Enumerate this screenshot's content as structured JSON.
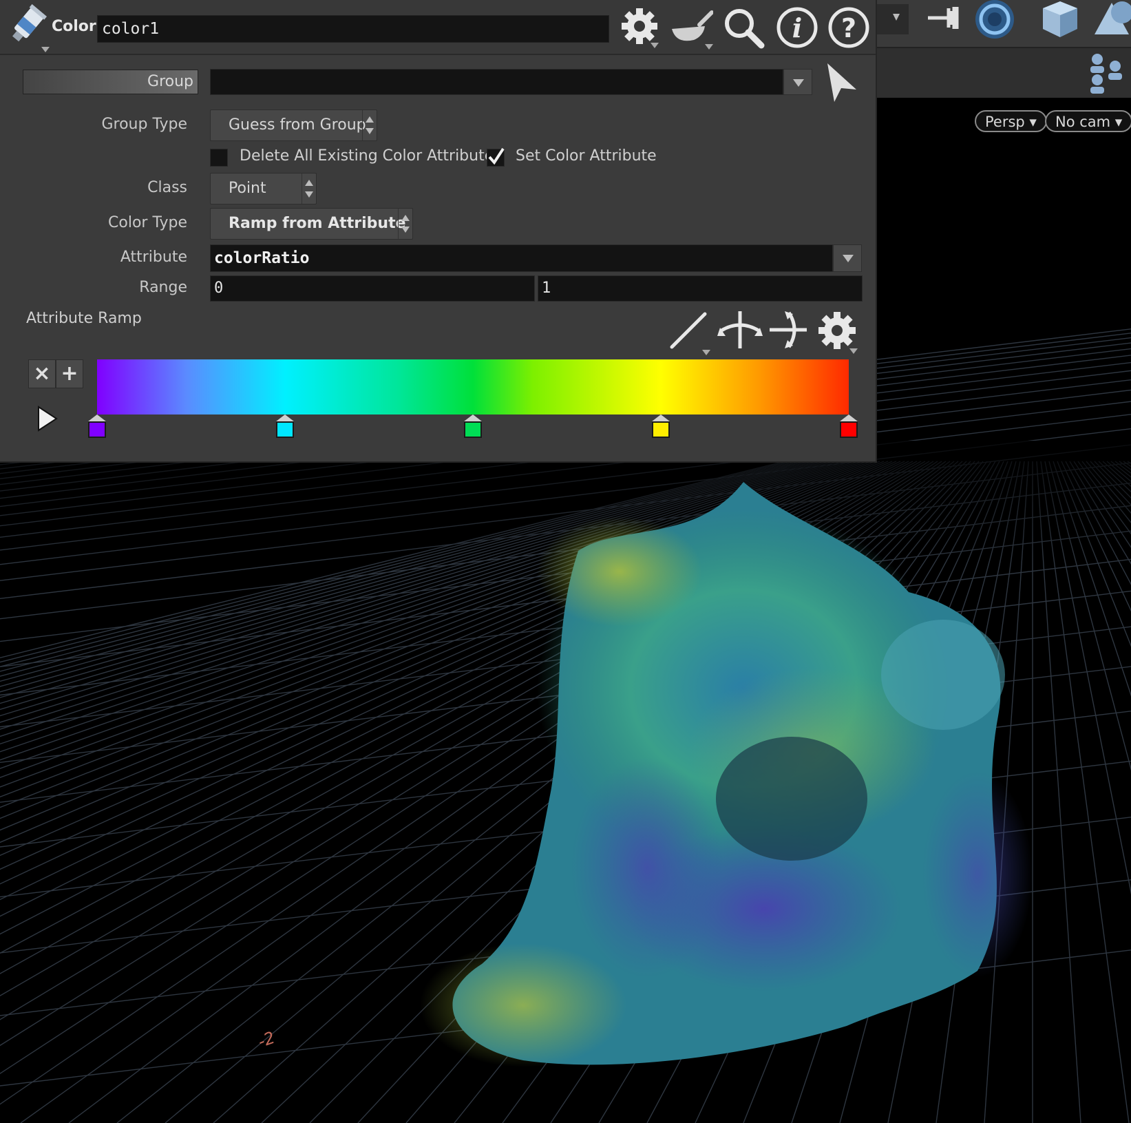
{
  "header": {
    "node_type": "Color",
    "node_name": "color1",
    "icons": [
      "paint-tube-icon",
      "gear-icon",
      "wok-icon",
      "magnifier-icon",
      "info-icon",
      "help-icon"
    ]
  },
  "params": {
    "group": {
      "label": "Group",
      "value": ""
    },
    "group_type": {
      "label": "Group Type",
      "value": "Guess from Group"
    },
    "delete_attrs": {
      "label": "Delete All Existing Color Attributes",
      "checked": false
    },
    "set_color": {
      "label": "Set Color Attribute",
      "checked": true
    },
    "class": {
      "label": "Class",
      "value": "Point"
    },
    "color_type": {
      "label": "Color Type",
      "value": "Ramp from Attribute"
    },
    "attribute": {
      "label": "Attribute",
      "value": "colorRatio"
    },
    "range": {
      "label": "Range",
      "min": "0",
      "max": "1"
    },
    "ramp": {
      "label": "Attribute Ramp",
      "keys": [
        {
          "pos": 0.0,
          "color": "#8000ff"
        },
        {
          "pos": 0.25,
          "color": "#00e6ff"
        },
        {
          "pos": 0.5,
          "color": "#00dd55"
        },
        {
          "pos": 0.75,
          "color": "#ffee00"
        },
        {
          "pos": 1.0,
          "color": "#ff0000"
        }
      ]
    }
  },
  "viewport": {
    "persp_label": "Persp",
    "cam_label": "No cam",
    "grid_tick_label": "-2"
  }
}
